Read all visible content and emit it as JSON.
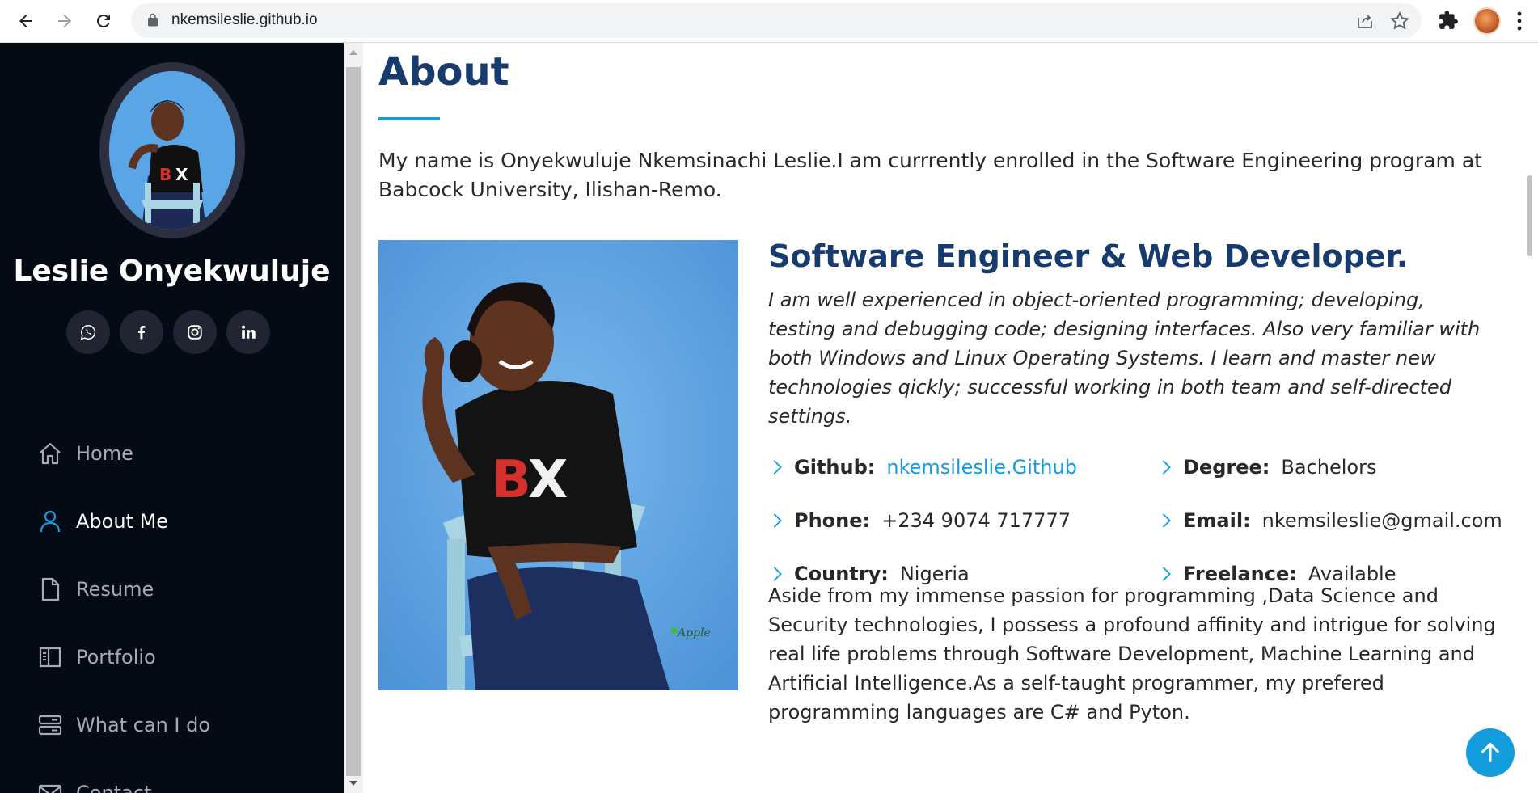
{
  "browser": {
    "url": "nkemsileslie.github.io"
  },
  "sidebar": {
    "name": "Leslie Onyekwuluje",
    "social": [
      {
        "icon": "whatsapp-icon"
      },
      {
        "icon": "facebook-icon"
      },
      {
        "icon": "instagram-icon"
      },
      {
        "icon": "linkedin-icon"
      }
    ],
    "nav": [
      {
        "label": "Home",
        "icon": "home-icon",
        "active": false
      },
      {
        "label": "About Me",
        "icon": "person-icon",
        "active": true
      },
      {
        "label": "Resume",
        "icon": "file-icon",
        "active": false
      },
      {
        "label": "Portfolio",
        "icon": "book-icon",
        "active": false
      },
      {
        "label": "What can I do",
        "icon": "server-icon",
        "active": false
      },
      {
        "label": "Contact",
        "icon": "envelope-icon",
        "active": false
      }
    ]
  },
  "about": {
    "title": "About",
    "intro": "My name is Onyekwuluje Nkemsinachi Leslie.I am currrently enrolled in the Software Engineering program at Babcock University, Ilishan-Remo.",
    "job_title": "Software Engineer & Web Developer.",
    "job_desc": "I am well experienced in object-oriented programming; developing, testing and debugging code; designing interfaces. Also very familiar with both Windows and Linux Operating Systems. I learn and master new technologies qickly; successful working in both team and self-directed settings.",
    "info": {
      "github_label": "Github:",
      "github_value": "nkemsileslie.Github",
      "degree_label": "Degree:",
      "degree_value": "Bachelors",
      "phone_label": "Phone:",
      "phone_value": "+234 9074 717777",
      "email_label": "Email:",
      "email_value": "nkemsileslie@gmail.com",
      "country_label": "Country:",
      "country_value": "Nigeria",
      "freelance_label": "Freelance:",
      "freelance_value": "Available"
    },
    "bio": "Aside from my immense passion for programming ,Data Science and Security technologies, I possess a profound affinity and intrigue for solving real life problems through Software Development, Machine Learning and Artificial Intelligence.As a self-taught programmer, my prefered programming languages are C# and Pyton."
  },
  "colors": {
    "accent": "#149ddd",
    "heading": "#173b6c",
    "sidebar_bg": "#040b14"
  }
}
